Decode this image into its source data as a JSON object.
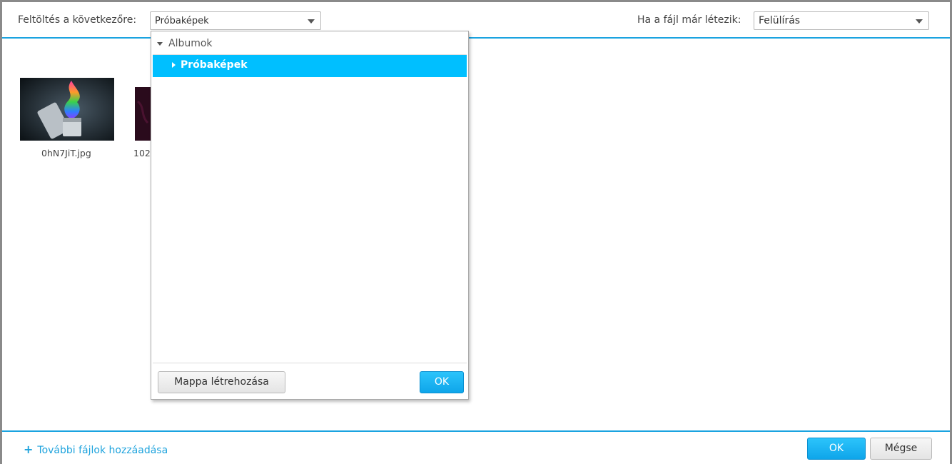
{
  "header": {
    "upload_to_label": "Feltöltés a következőre:",
    "upload_to_value": "Próbaképek",
    "if_exists_label": "Ha a fájl már létezik:",
    "if_exists_value": "Felülírás"
  },
  "thumbnails": [
    {
      "name": "0hN7JiT.jpg",
      "icon": "lighter-photo"
    },
    {
      "name": "102",
      "icon": "dark-photo"
    }
  ],
  "dropdown": {
    "root_label": "Albumok",
    "items": [
      {
        "label": "Próbaképek",
        "selected": true
      }
    ],
    "create_folder_label": "Mappa létrehozása",
    "ok_label": "OK"
  },
  "footer": {
    "add_more_label": "További fájlok hozzáadása",
    "ok_label": "OK",
    "cancel_label": "Mégse"
  },
  "colors": {
    "accent": "#1aa3e0",
    "selection": "#00bfff"
  }
}
